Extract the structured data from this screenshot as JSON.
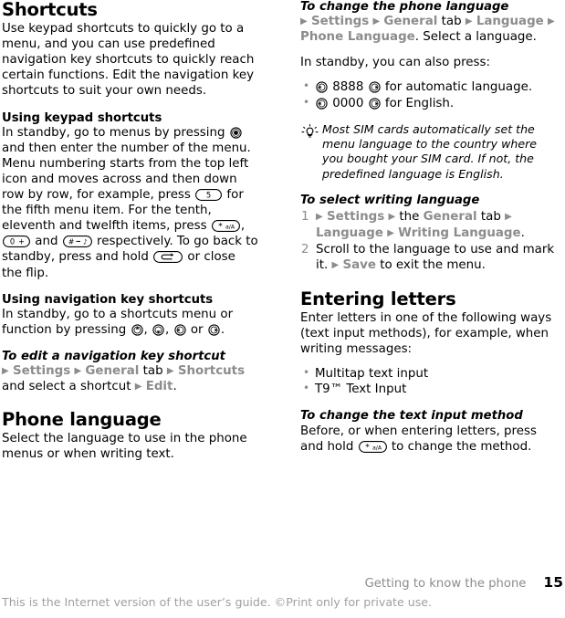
{
  "document": {
    "chapter": "Getting to know the phone",
    "page_number": "15",
    "disclaimer": "This is the Internet version of the user’s guide. ©Print only for private use."
  },
  "left_column": {
    "section_title": "Shortcuts",
    "intro": "Use keypad shortcuts to quickly go to a menu, and you can use predefined navigation key shortcuts to quickly reach certain functions. Edit the navigation key shortcuts to suit your own needs.",
    "keypad": {
      "heading": "Using keypad shortcuts",
      "text_1": "In standby, go to menus by pressing",
      "text_2": "and then enter the number of the menu. Menu numbering starts from the top left icon and moves across and then down row by row, for example, press",
      "text_3": "for the fifth menu item. For the tenth, eleventh and twelfth items, press",
      "text_4": ",",
      "text_5": "and",
      "text_6": "respectively. To go back to standby, press and hold",
      "text_7": "or close the flip.",
      "icon_select": "select-key-icon",
      "icon_five": "key-5-icon",
      "icon_star": "key-star-icon",
      "icon_zero": "key-0-icon",
      "icon_hash": "key-hash-icon",
      "icon_back": "back-key-icon"
    },
    "navigation": {
      "heading": "Using navigation key shortcuts",
      "text_1": "In standby, go to a shortcuts menu or function by pressing",
      "text_2": ",",
      "text_3": ",",
      "text_4": "or",
      "text_5": ".",
      "icon_up": "nav-key-up-icon",
      "icon_down": "nav-key-down-icon",
      "icon_left": "nav-key-left-icon",
      "icon_right": "nav-key-right-icon"
    },
    "edit_shortcut": {
      "heading": "To edit a navigation key shortcut",
      "menu_settings": "Settings",
      "menu_general": "General",
      "word_tab": "tab",
      "menu_shortcuts": "Shortcuts",
      "text_tail": "and select a shortcut",
      "menu_edit": "Edit",
      "period": "."
    },
    "phone_language": {
      "heading": "Phone language",
      "text": "Select the language to use in the phone menus or when writing text."
    }
  },
  "right_column": {
    "change_language": {
      "heading": "To change the phone language",
      "menu_settings": "Settings",
      "menu_general": "General",
      "word_tab": "tab",
      "menu_language": "Language",
      "menu_phone_language": "Phone Language",
      "text_tail": ". Select a language.",
      "standby_text": "In standby, you can also press:",
      "bullets": [
        {
          "code": "8888",
          "text": "for automatic language."
        },
        {
          "code": "0000",
          "text": "for English."
        }
      ],
      "icon_left": "nav-key-left-icon",
      "icon_right": "nav-key-right-icon"
    },
    "tip": {
      "icon": "lightbulb-tip-icon",
      "text": "Most SIM cards automatically set the menu language to the country where you bought your SIM card. If not, the predefined language is English."
    },
    "writing_language": {
      "heading": "To select writing language",
      "step1_a": "Settings",
      "step1_the": "the",
      "step1_general": "General",
      "step1_tab": "tab",
      "step1_language": "Language",
      "step1_writing": "Writing Language",
      "step1_end": ".",
      "step2_a": "Scroll to the language to use and mark it.",
      "step2_save": "Save",
      "step2_b": "to exit the menu."
    },
    "entering_letters": {
      "heading": "Entering letters",
      "text": "Enter letters in one of the following ways (text input methods), for example, when writing messages:",
      "bullets": [
        "Multitap text input",
        "T9™ Text Input"
      ]
    },
    "change_input": {
      "heading": "To change the text input method",
      "text_1": "Before, or when entering letters, press and hold",
      "text_2": "to change the method.",
      "icon_star": "key-star-icon"
    }
  }
}
